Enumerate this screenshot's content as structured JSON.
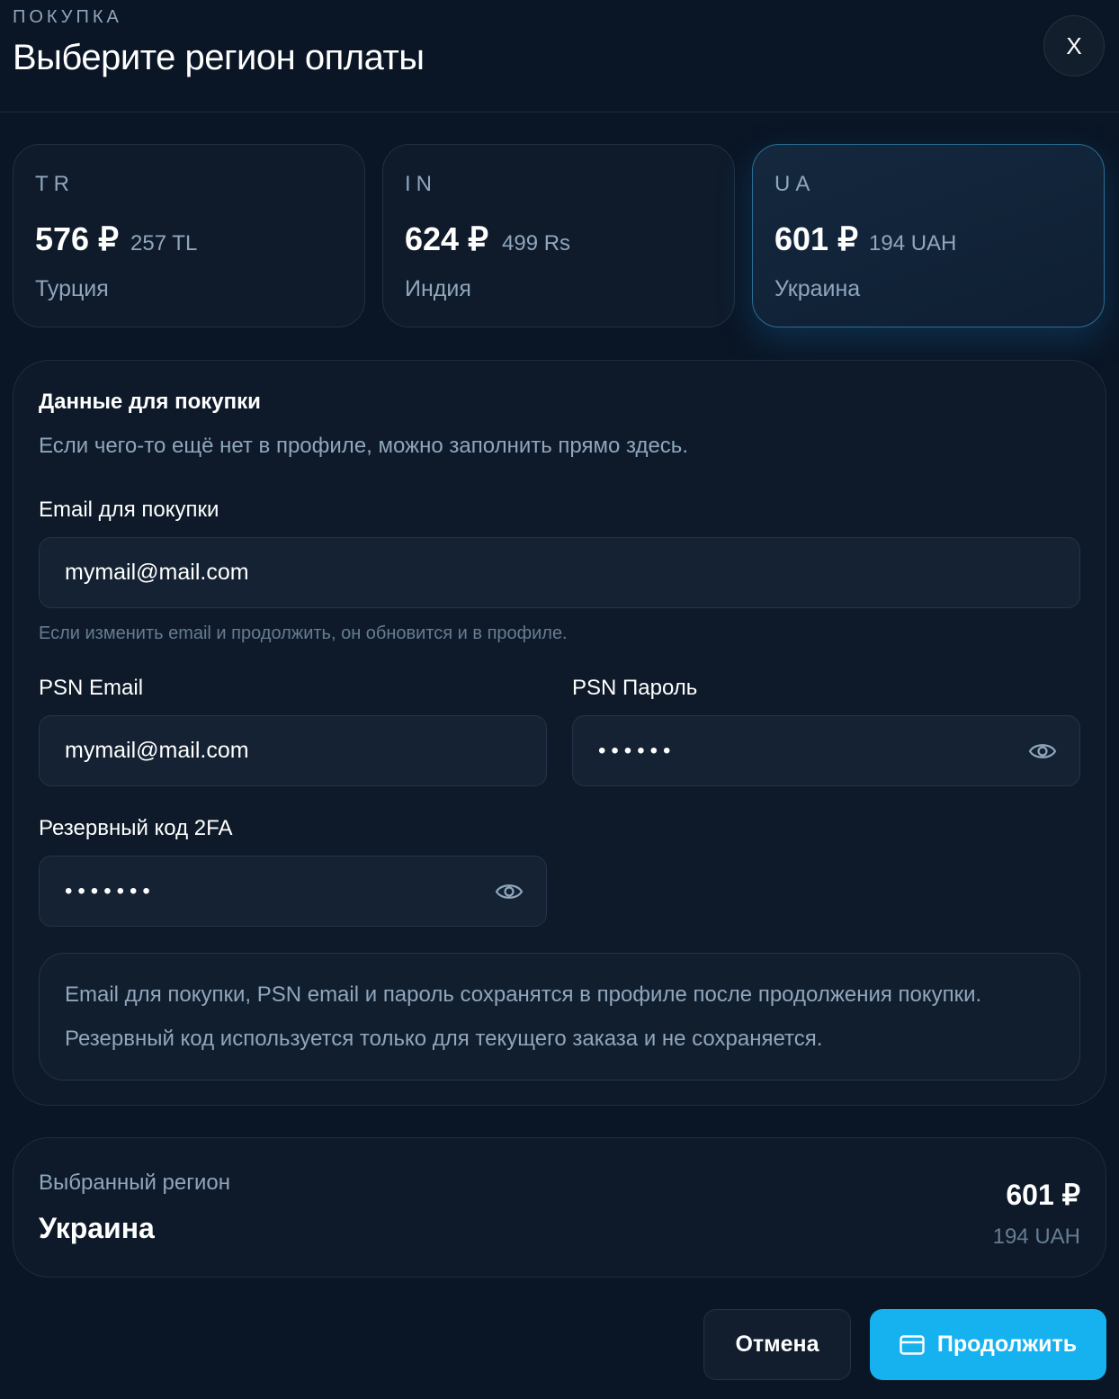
{
  "header": {
    "kicker": "ПОКУПКА",
    "title": "Выберите регион оплаты",
    "close_label": "X"
  },
  "regions": [
    {
      "code": "TR",
      "price": "576 ₽",
      "local_price": "257 TL",
      "name": "Турция",
      "selected": false
    },
    {
      "code": "IN",
      "price": "624 ₽",
      "local_price": "499 Rs",
      "name": "Индия",
      "selected": false
    },
    {
      "code": "UA",
      "price": "601 ₽",
      "local_price": "194 UAH",
      "name": "Украина",
      "selected": true
    }
  ],
  "form": {
    "heading": "Данные для покупки",
    "subtitle": "Если чего-то ещё нет в профиле, можно заполнить прямо здесь.",
    "purchase_email": {
      "label": "Email для покупки",
      "value": "mymail@mail.com",
      "hint": "Если изменить email и продолжить, он обновится и в профиле."
    },
    "psn_email": {
      "label": "PSN Email",
      "value": "mymail@mail.com"
    },
    "psn_password": {
      "label": "PSN Пароль",
      "value": "••••••"
    },
    "backup_code": {
      "label": "Резервный код 2FA",
      "value": "•••••••"
    },
    "note": {
      "line1": "Email для покупки, PSN email и пароль сохранятся в профиле после продолжения покупки.",
      "line2": "Резервный код используется только для текущего заказа и не сохраняется."
    }
  },
  "summary": {
    "label": "Выбранный регион",
    "region": "Украина",
    "price": "601 ₽",
    "local_price": "194 UAH"
  },
  "actions": {
    "cancel_label": "Отмена",
    "continue_label": "Продолжить",
    "continue_icon": "credit-card-icon",
    "password_toggle_icon": "eye-icon"
  },
  "colors": {
    "background": "#0a1525",
    "accent": "#16b2ef",
    "selected_border": "#2a6e93",
    "muted_text": "#8fa6bd"
  }
}
